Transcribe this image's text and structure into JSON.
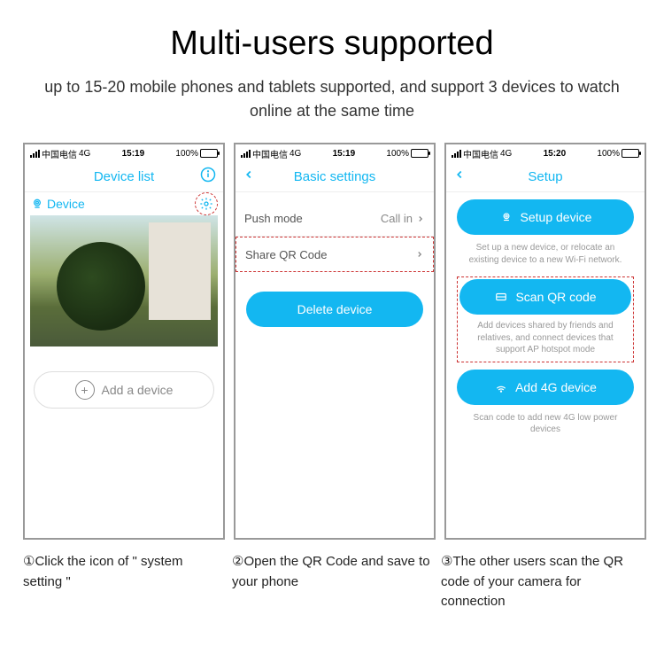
{
  "header": {
    "title": "Multi-users supported",
    "subtitle": "up to 15-20 mobile phones and tablets supported, and support 3 devices to watch online at the same time"
  },
  "statusbar_common": {
    "carrier": "中国电信",
    "network": "4G",
    "battery_pct": "100%"
  },
  "screens": [
    {
      "time": "15:19",
      "nav_title": "Device list",
      "device_label": "Device",
      "add_device_label": "Add a device",
      "caption": "①Click the icon of \" system setting \""
    },
    {
      "time": "15:19",
      "nav_title": "Basic settings",
      "rows": [
        {
          "label": "Push mode",
          "value": "Call in"
        },
        {
          "label": "Share QR Code",
          "value": ""
        }
      ],
      "delete_label": "Delete device",
      "caption": "②Open the QR Code and save to your phone"
    },
    {
      "time": "15:20",
      "nav_title": "Setup",
      "setup_device": {
        "label": "Setup device",
        "desc": "Set up a new device, or relocate an existing device to a new Wi-Fi network."
      },
      "scan_qr": {
        "label": "Scan QR code",
        "desc": "Add devices shared by friends and relatives, and connect devices that support AP hotspot mode"
      },
      "add_4g": {
        "label": "Add 4G device",
        "desc": "Scan code to add new 4G low power devices"
      },
      "caption": "③The other users scan the QR code of your camera for connection"
    }
  ]
}
